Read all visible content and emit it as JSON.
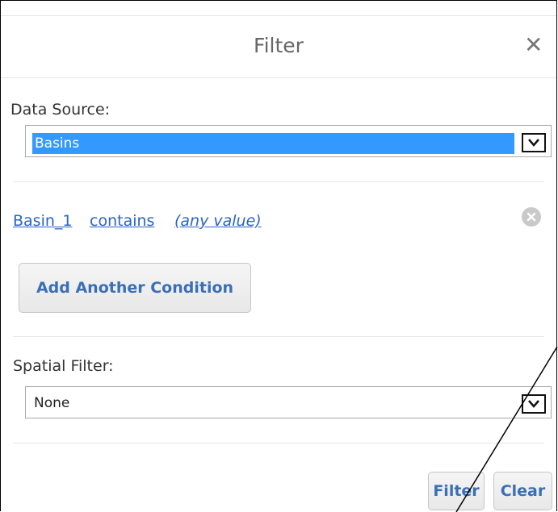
{
  "dialog": {
    "title": "Filter",
    "close_glyph": "✕"
  },
  "data_source": {
    "label": "Data Source:",
    "selected": "Basins"
  },
  "condition": {
    "field": "Basin_1",
    "operator": "contains",
    "value": "(any value)"
  },
  "add_condition_label": "Add Another Condition",
  "spatial_filter": {
    "label": "Spatial Filter:",
    "selected": "None"
  },
  "footer": {
    "filter_label": "Filter",
    "clear_label": "Clear"
  },
  "colors": {
    "link": "#2b64c7",
    "selection": "#3399ff",
    "button_text": "#3a6fb6"
  }
}
